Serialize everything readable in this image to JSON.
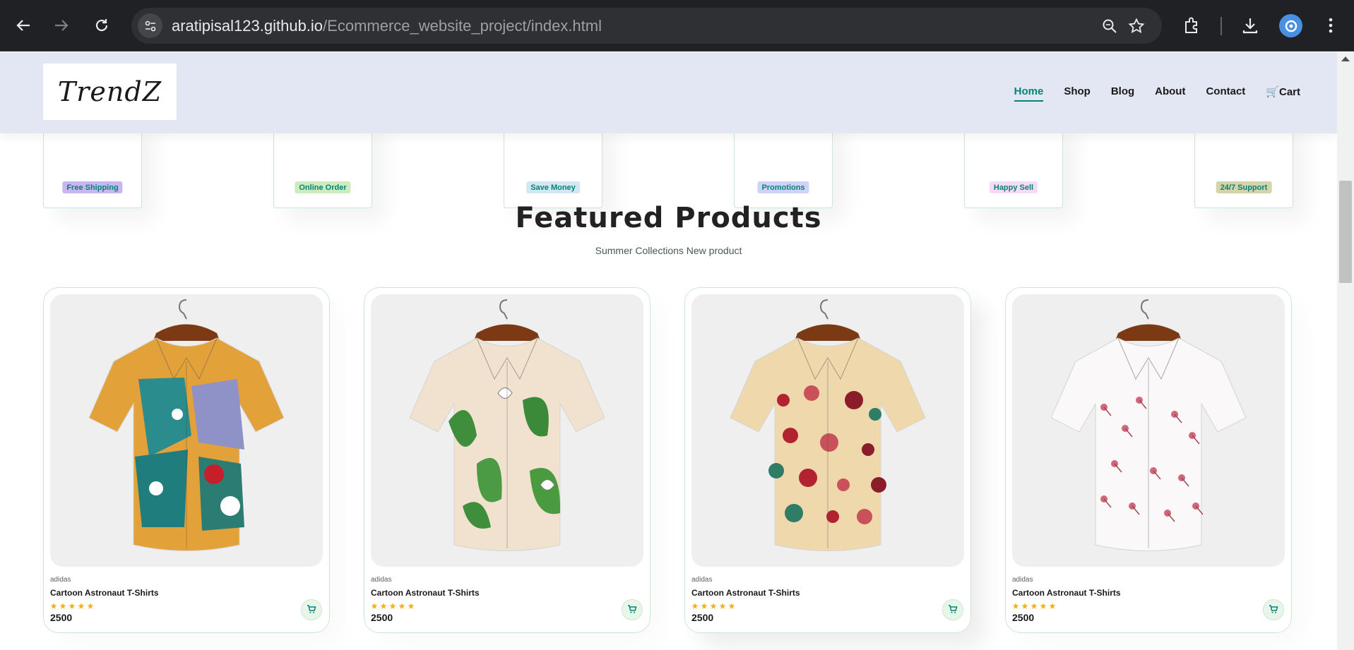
{
  "browser": {
    "url_domain": "aratipisal123.github.io",
    "url_path": "/Ecommerce_website_project/index.html"
  },
  "header": {
    "logo_text": "TrendZ",
    "nav": [
      {
        "label": "Home",
        "active": true
      },
      {
        "label": "Shop",
        "active": false
      },
      {
        "label": "Blog",
        "active": false
      },
      {
        "label": "About",
        "active": false
      },
      {
        "label": "Contact",
        "active": false
      },
      {
        "label": "🛒Cart",
        "active": false
      }
    ]
  },
  "features": [
    {
      "label": "Free Shipping",
      "color": "#c7b6f0"
    },
    {
      "label": "Online Order",
      "color": "#cdebbc"
    },
    {
      "label": "Save Money",
      "color": "#d1e8f2"
    },
    {
      "label": "Promotions",
      "color": "#cdd4f8"
    },
    {
      "label": "Happy Sell",
      "color": "#f6dbf6"
    },
    {
      "label": "24/7 Support",
      "color": "#d4d4a8"
    }
  ],
  "featured": {
    "title": "Featured Products",
    "subtitle": "Summer Collections New product"
  },
  "products": [
    {
      "brand": "adidas",
      "name": "Cartoon Astronaut T-Shirts",
      "rating": 5,
      "price": "2500",
      "pattern": "abstract"
    },
    {
      "brand": "adidas",
      "name": "Cartoon Astronaut T-Shirts",
      "rating": 5,
      "price": "2500",
      "pattern": "leaves"
    },
    {
      "brand": "adidas",
      "name": "Cartoon Astronaut T-Shirts",
      "rating": 5,
      "price": "2500",
      "pattern": "roses"
    },
    {
      "brand": "adidas",
      "name": "Cartoon Astronaut T-Shirts",
      "rating": 5,
      "price": "2500",
      "pattern": "blossom"
    }
  ],
  "colors": {
    "accent": "#088178",
    "header_bg": "#e3e6f3",
    "star": "#f3b519",
    "border": "#cce7d0"
  }
}
